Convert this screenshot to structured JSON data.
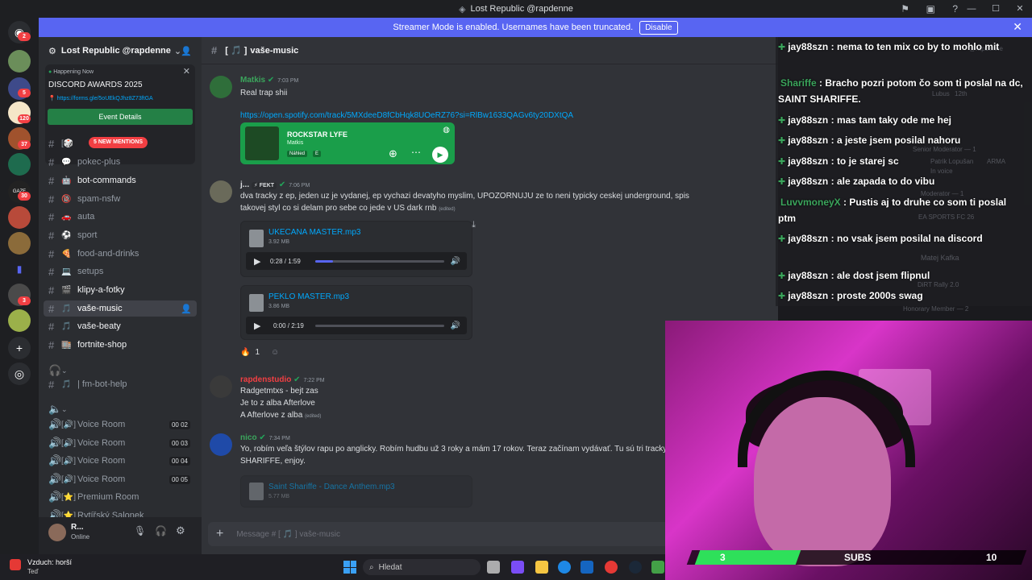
{
  "window": {
    "title": "Lost Republic @rapdenne"
  },
  "banner": {
    "text": "Streamer Mode is enabled. Usernames have been truncated.",
    "button": "Disable"
  },
  "rail": {
    "badges": [
      "2",
      "5",
      "120",
      "37",
      "30",
      "3"
    ]
  },
  "guild": {
    "name": "Lost Republic @rapdenne",
    "event": {
      "status": "Happening Now",
      "title": "DISCORD AWARDS 2025",
      "link": "https://forms.gle/5oUEkQJhz8Z73ftGA",
      "button": "Event Details"
    },
    "new_mentions": "5 NEW MENTIONS",
    "channels": [
      {
        "emoji": "💬",
        "name": "pokec-plus"
      },
      {
        "emoji": "🤖",
        "name": "bot-commands"
      },
      {
        "emoji": "🔞",
        "name": "spam-nsfw"
      },
      {
        "emoji": "🚗",
        "name": "auta"
      },
      {
        "emoji": "⚽",
        "name": "sport"
      },
      {
        "emoji": "🍕",
        "name": "food-and-drinks"
      },
      {
        "emoji": "💻",
        "name": "setups"
      },
      {
        "emoji": "🎬",
        "name": "klipy-a-fotky"
      },
      {
        "emoji": "🎵",
        "name": "vaše-music"
      },
      {
        "emoji": "🎵",
        "name": "vaše-beaty"
      },
      {
        "emoji": "🏬",
        "name": "fortnite-shop"
      }
    ],
    "bot_channel": "| fm-bot-help",
    "voice": [
      {
        "name": "Voice Room",
        "count": "00 02"
      },
      {
        "name": "Voice Room",
        "count": "00 03"
      },
      {
        "name": "Voice Room",
        "count": "00 04"
      },
      {
        "name": "Voice Room",
        "count": "00 05"
      },
      {
        "name": "Premium Room",
        "count": ""
      },
      {
        "name": "Rytířský Salonek",
        "count": ""
      }
    ]
  },
  "user": {
    "name": "R...",
    "status": "Online"
  },
  "channel": {
    "name": "vaše-music",
    "composer_placeholder": "Message # [ 🎵 ] vaše-music"
  },
  "messages": [
    {
      "author": "Matkis",
      "time": "7:03 PM",
      "color": "#3ba55c",
      "text": "Real trap shii",
      "link": "https://open.spotify.com/track/5MXdeeD8fCbHqk8UOeRZ76?si=RlBw1633QAGv6ty20DXtQA",
      "spotify": {
        "title": "ROCKSTAR LYFE",
        "artist": "Matkis",
        "tag": "Náhled",
        "explicit": "E"
      }
    },
    {
      "author": "j...",
      "tag": "FEKT",
      "time": "7:06 PM",
      "color": "#dbdee1",
      "text": "dva tracky z ep, jeden uz je vydanej, ep vychazi devatyho myslim, UPOZORNUJU ze to neni typicky ceskej underground, spis takovej styl co si delam pro sebe co jede v US dark rnb",
      "edited": "(edited)",
      "files": [
        {
          "name": "UKECANA MASTER.mp3",
          "size": "3.92 MB",
          "time": "0:28 / 1:59",
          "progress": 0.14
        },
        {
          "name": "PEKLO MASTER.mp3",
          "size": "3.86 MB",
          "time": "0:00 / 2:19",
          "progress": 0.0
        }
      ],
      "reaction": {
        "emoji": "🔥",
        "count": "1"
      }
    },
    {
      "author": "rapdenstudio",
      "time": "7:22 PM",
      "color": "#f23f43",
      "lines": [
        "Radgetmtxs - bejt zas",
        "Je to z alba Afterlove",
        "A Afterlove z alba"
      ],
      "edited": "(edited)"
    },
    {
      "author": "nico",
      "time": "7:34 PM",
      "color": "#3ba55c",
      "text": "Yo, robím veľa štýlov rapu po anglicky. Robím hudbu už 3 roky a mám 17 rokov. Teraz začínam vydávať.  Tu sú tri tracky SHARIFFE, enjoy.",
      "files": [
        {
          "name": "Saint Shariffe - Dance Anthem.mp3",
          "size": "5.77 MB"
        }
      ]
    }
  ],
  "overlay": [
    {
      "user": "jay88szn",
      "text": ": nema to ten mix co by to mohlo mit",
      "color": "#3ba55c"
    },
    {
      "user": "Shariffe",
      "text": ": Bracho pozri potom čo som ti poslal na dc, SAINT SHARIFFE.",
      "color": "#3ba55c"
    },
    {
      "user": "jay88szn",
      "text": ": mas tam taky ode me hej",
      "color": "#3ba55c"
    },
    {
      "user": "jay88szn",
      "text": ": a jeste jsem posilal nahoru",
      "color": "#3ba55c"
    },
    {
      "user": "jay88szn",
      "text": ": to je starej sc",
      "color": "#3ba55c"
    },
    {
      "user": "jay88szn",
      "text": ": ale zapada to do vibu",
      "color": "#3ba55c"
    },
    {
      "user": "LuvvmoneyX",
      "text": ": Pustis aj to druhe co som ti poslal ptm",
      "color": "#3ba55c"
    },
    {
      "user": "jay88szn",
      "text": ": no vsak jsem posilal na discord",
      "color": "#3ba55c"
    },
    {
      "user": "jay88szn",
      "text": ": ale dost jsem flipnul",
      "color": "#3ba55c"
    },
    {
      "user": "jay88szn",
      "text": ": proste 2000s swag",
      "color": "#3ba55c"
    }
  ],
  "members_ghost": [
    "Senior Moderator — 1",
    "Patrik Lopušan",
    "ARMA",
    "In voice",
    "Moderator — 1",
    "EA SPORTS FC 26",
    "Matej Kafka",
    "DiRT Rally 2.0",
    "Honorary Member — 2",
    "12th",
    "Lubus"
  ],
  "webcam": {
    "subs_current": "3",
    "subs_label": "SUBS",
    "subs_goal": "10"
  },
  "taskbar": {
    "weather": "Vzduch: horší",
    "weather_sub": "Teď",
    "search": "Hledat"
  }
}
